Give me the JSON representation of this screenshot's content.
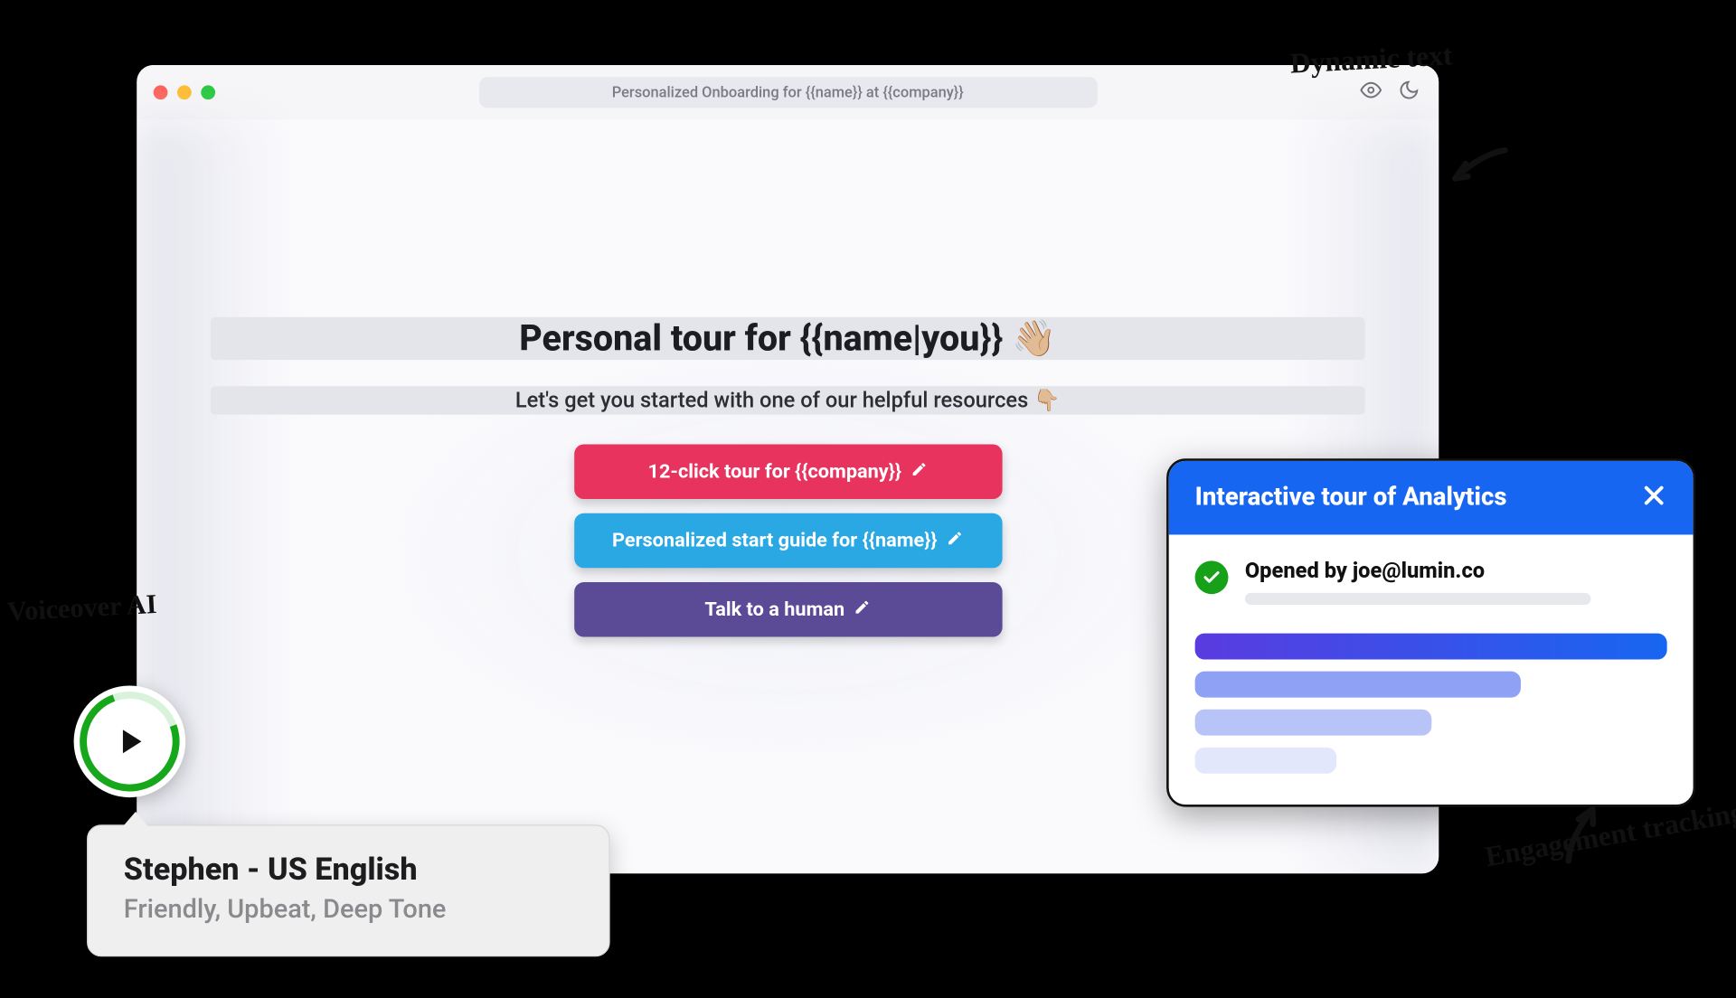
{
  "window": {
    "title": "Personalized Onboarding for {{name}} at {{company}}"
  },
  "hero": {
    "headline": "Personal tour for {{name|you}} 👋🏼",
    "subline": "Let's get you started with one of our helpful resources 👇🏼"
  },
  "ctas": {
    "tour": "12-click tour for {{company}}",
    "guide": "Personalized start guide for {{name}}",
    "human": "Talk to a human"
  },
  "voice": {
    "name": "Stephen - US English",
    "desc": "Friendly, Upbeat, Deep Tone"
  },
  "analytics": {
    "title": "Interactive tour of Analytics",
    "opened": "Opened by joe@lumin.co"
  },
  "annotations": {
    "dynamic": "Dynamic text",
    "voice": "Voiceover AI",
    "tracking": "Engagement tracking"
  }
}
